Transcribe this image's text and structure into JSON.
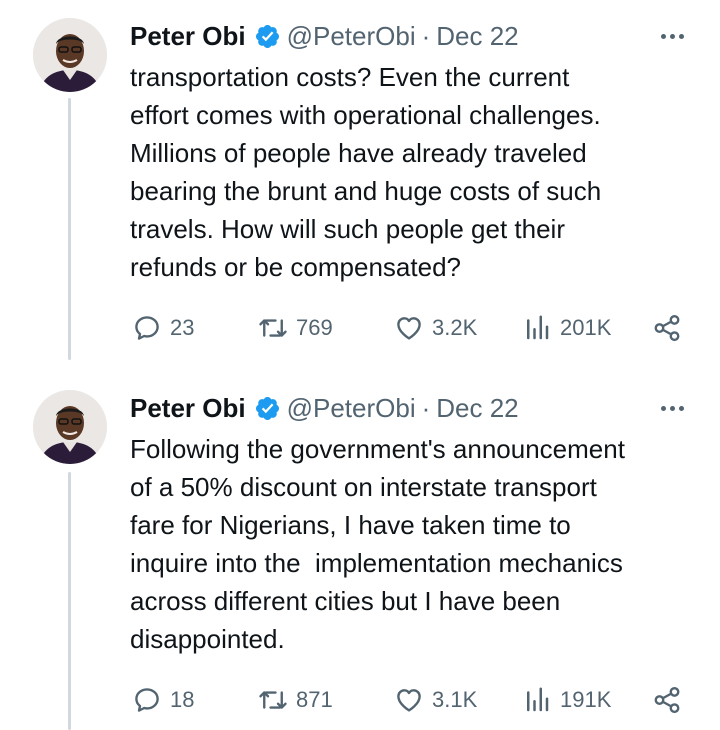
{
  "tweets": [
    {
      "author_name": "Peter Obi",
      "handle": "@PeterObi",
      "separator": "·",
      "date": "Dec 22",
      "text": "transportation costs? Even the current\neffort comes with operational challenges.\nMillions of people have already traveled\nbearing the brunt and huge costs of such\ntravels. How will such people get their\nrefunds or be compensated?",
      "replies": "23",
      "reposts": "769",
      "likes": "3.2K",
      "views": "201K"
    },
    {
      "author_name": "Peter Obi",
      "handle": "@PeterObi",
      "separator": "·",
      "date": "Dec 22",
      "text": "Following the government's announcement\nof a 50% discount on interstate transport\nfare for Nigerians, I have taken time to\ninquire into the  implementation mechanics\nacross different cities but I have been\ndisappointed.",
      "replies": "18",
      "reposts": "871",
      "likes": "3.1K",
      "views": "191K"
    }
  ],
  "colors": {
    "text": "#0f1419",
    "secondary": "#536471",
    "verified_badge": "#1d9bf0",
    "thread_line": "#cfd9de"
  },
  "icons": {
    "reply": "speech-bubble-icon",
    "repost": "repost-arrows-icon",
    "like": "heart-icon",
    "views": "bar-chart-icon",
    "share": "share-icon",
    "more": "ellipsis-icon",
    "verified": "verified-badge-icon"
  }
}
